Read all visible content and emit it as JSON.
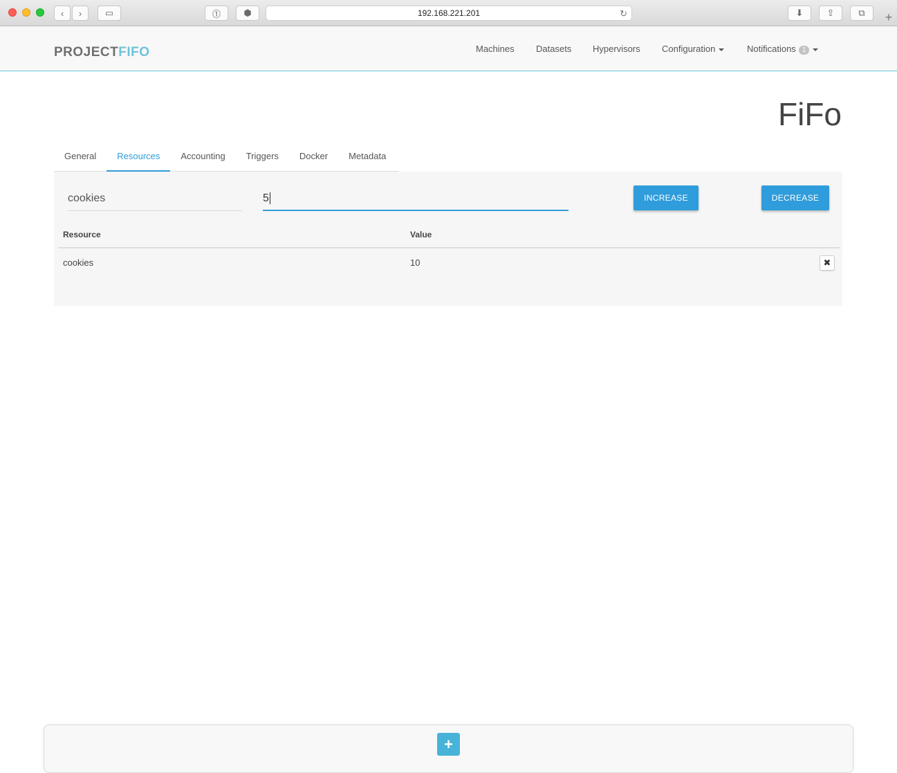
{
  "browser": {
    "url": "192.168.221.201"
  },
  "navbar": {
    "logo_part1": "PROJECT",
    "logo_part2": "FIFO",
    "links": {
      "machines": "Machines",
      "datasets": "Datasets",
      "hypervisors": "Hypervisors",
      "configuration": "Configuration",
      "notifications": "Notifications",
      "notification_count": "1"
    }
  },
  "page": {
    "title": "FiFo"
  },
  "tabs": [
    "General",
    "Resources",
    "Accounting",
    "Triggers",
    "Docker",
    "Metadata"
  ],
  "active_tab": "Resources",
  "form": {
    "resource_name": "cookies",
    "amount_value": "5",
    "increase_label": "INCREASE",
    "decrease_label": "DECREASE"
  },
  "table": {
    "headers": [
      "Resource",
      "Value"
    ],
    "rows": [
      {
        "resource": "cookies",
        "value": "10"
      }
    ]
  },
  "icons": {
    "delete": "times-icon",
    "add": "plus-icon"
  },
  "colors": {
    "accent": "#2f9cdb",
    "logo_accent": "#6cc3dc"
  }
}
